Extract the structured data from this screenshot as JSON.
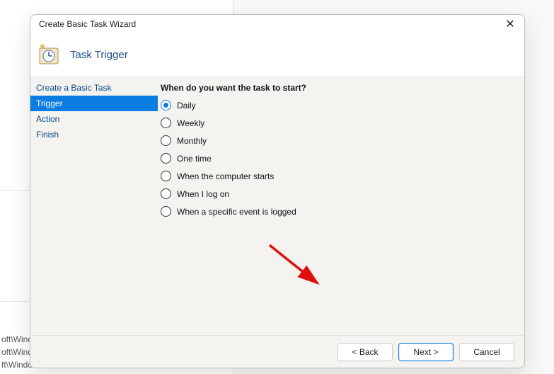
{
  "bg": {
    "line1": "oft\\Windo",
    "line2": "oft\\Windows\\U...",
    "line3": "ft\\Windows\\Eli"
  },
  "dialog": {
    "title": "Create Basic Task Wizard",
    "header": "Task Trigger"
  },
  "nav": {
    "items": [
      {
        "label": "Create a Basic Task",
        "selected": false
      },
      {
        "label": "Trigger",
        "selected": true
      },
      {
        "label": "Action",
        "selected": false
      },
      {
        "label": "Finish",
        "selected": false
      }
    ]
  },
  "content": {
    "prompt": "When do you want the task to start?",
    "options": [
      {
        "label": "Daily",
        "checked": true
      },
      {
        "label": "Weekly",
        "checked": false
      },
      {
        "label": "Monthly",
        "checked": false
      },
      {
        "label": "One time",
        "checked": false
      },
      {
        "label": "When the computer starts",
        "checked": false
      },
      {
        "label": "When I log on",
        "checked": false
      },
      {
        "label": "When a specific event is logged",
        "checked": false
      }
    ]
  },
  "footer": {
    "back": "< Back",
    "next": "Next >",
    "cancel": "Cancel"
  }
}
